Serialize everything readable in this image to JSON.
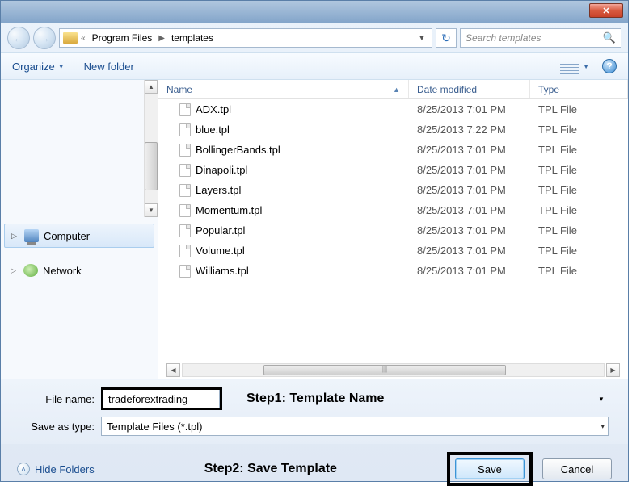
{
  "titlebar": {
    "close_glyph": "✕"
  },
  "nav": {
    "back_glyph": "←",
    "fwd_glyph": "→",
    "path_sep1_glyph": "«",
    "path1": "Program Files",
    "path_sep2_glyph": "▶",
    "path2": "templates",
    "path_dd_glyph": "▼",
    "refresh_glyph": "↻",
    "search_placeholder": "Search templates",
    "search_glyph": "🔍"
  },
  "toolbar": {
    "organize_label": "Organize",
    "organize_dd": "▼",
    "newfolder_label": "New folder",
    "view_dd": "▼",
    "help_glyph": "?"
  },
  "sidebar": {
    "computer_label": "Computer",
    "network_label": "Network",
    "arrow_expanded": "▷",
    "arrow_collapsed": "▷",
    "scroll_up": "▲",
    "scroll_down": "▼"
  },
  "columns": {
    "name": "Name",
    "date": "Date modified",
    "type": "Type",
    "sort_glyph": "▲"
  },
  "files": [
    {
      "name": "ADX.tpl",
      "date": "8/25/2013 7:01 PM",
      "type": "TPL File"
    },
    {
      "name": "blue.tpl",
      "date": "8/25/2013 7:22 PM",
      "type": "TPL File"
    },
    {
      "name": "BollingerBands.tpl",
      "date": "8/25/2013 7:01 PM",
      "type": "TPL File"
    },
    {
      "name": "Dinapoli.tpl",
      "date": "8/25/2013 7:01 PM",
      "type": "TPL File"
    },
    {
      "name": "Layers.tpl",
      "date": "8/25/2013 7:01 PM",
      "type": "TPL File"
    },
    {
      "name": "Momentum.tpl",
      "date": "8/25/2013 7:01 PM",
      "type": "TPL File"
    },
    {
      "name": "Popular.tpl",
      "date": "8/25/2013 7:01 PM",
      "type": "TPL File"
    },
    {
      "name": "Volume.tpl",
      "date": "8/25/2013 7:01 PM",
      "type": "TPL File"
    },
    {
      "name": "Williams.tpl",
      "date": "8/25/2013 7:01 PM",
      "type": "TPL File"
    }
  ],
  "hscroll": {
    "left": "◀",
    "right": "▶",
    "grip": "|||"
  },
  "form": {
    "filename_label": "File name:",
    "filename_value": "tradeforextrading",
    "saveas_label": "Save as type:",
    "saveas_value": "Template Files (*.tpl)",
    "dd_glyph": "▾"
  },
  "annotations": {
    "step1": "Step1: Template Name",
    "step2": "Step2: Save Template"
  },
  "bottom": {
    "hide_label": "Hide Folders",
    "hide_glyph": "˄",
    "save_label": "Save",
    "cancel_label": "Cancel"
  }
}
